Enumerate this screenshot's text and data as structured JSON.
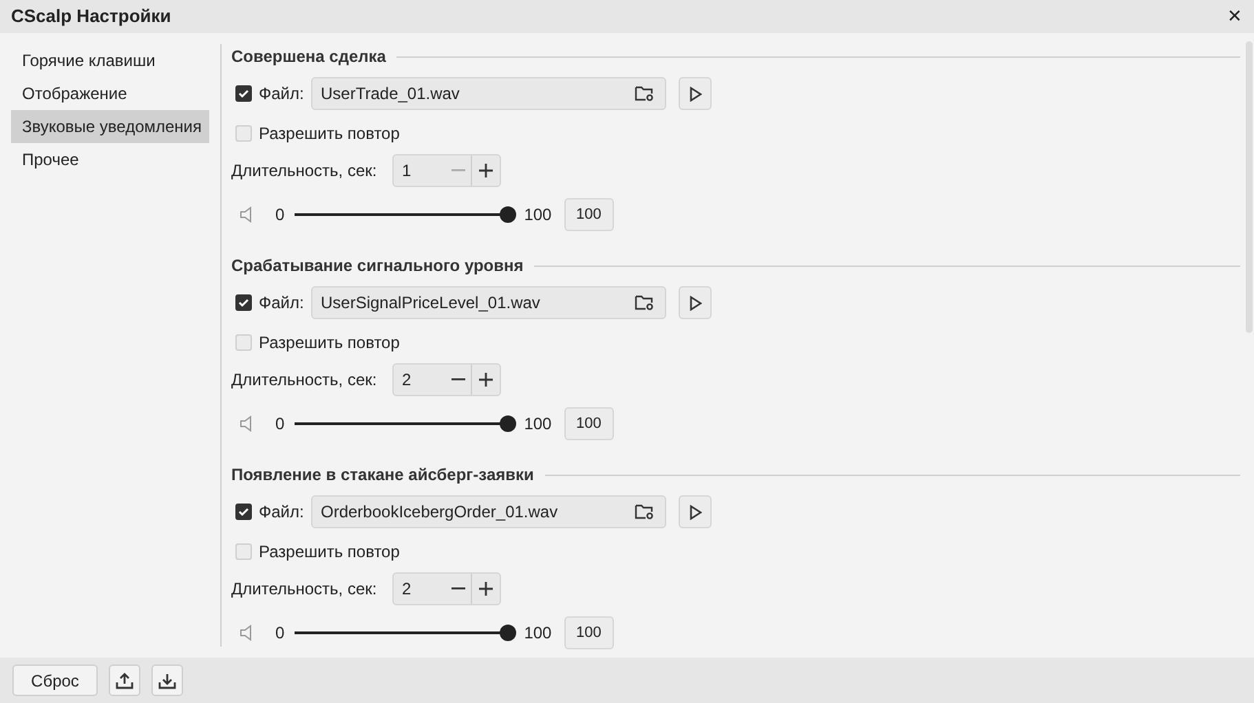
{
  "window": {
    "title": "CScalp Настройки",
    "close": "✕"
  },
  "sidebar": {
    "items": [
      {
        "label": "Горячие клавиши",
        "selected": false
      },
      {
        "label": "Отображение",
        "selected": false
      },
      {
        "label": "Звуковые уведомления",
        "selected": true
      },
      {
        "label": "Прочее",
        "selected": false
      }
    ]
  },
  "sections": [
    {
      "title": "Совершена сделка",
      "file_enabled": true,
      "file_label": "Файл:",
      "file": "UserTrade_01.wav",
      "repeat_label": "Разрешить повтор",
      "repeat": false,
      "duration_label": "Длительность, сек:",
      "duration": "1",
      "decrement_disabled": true,
      "volume_min": "0",
      "volume_max": "100",
      "volume": {
        "level": 1
      },
      "volume_value": "100"
    },
    {
      "title": "Срабатывание сигнального уровня",
      "file_enabled": true,
      "file_label": "Файл:",
      "file": "UserSignalPriceLevel_01.wav",
      "repeat_label": "Разрешить повтор",
      "repeat": false,
      "duration_label": "Длительность, сек:",
      "duration": "2",
      "decrement_disabled": false,
      "volume_min": "0",
      "volume_max": "100",
      "volume": {
        "level": 1
      },
      "volume_value": "100"
    },
    {
      "title": "Появление в стакане айсберг-заявки",
      "file_enabled": true,
      "file_label": "Файл:",
      "file": "OrderbookIcebergOrder_01.wav",
      "repeat_label": "Разрешить повтор",
      "repeat": false,
      "duration_label": "Длительность, сек:",
      "duration": "2",
      "decrement_disabled": false,
      "volume_min": "0",
      "volume_max": "100",
      "volume": {
        "level": 1
      },
      "volume_value": "100"
    }
  ],
  "footer": {
    "reset_button": "Сброс"
  }
}
